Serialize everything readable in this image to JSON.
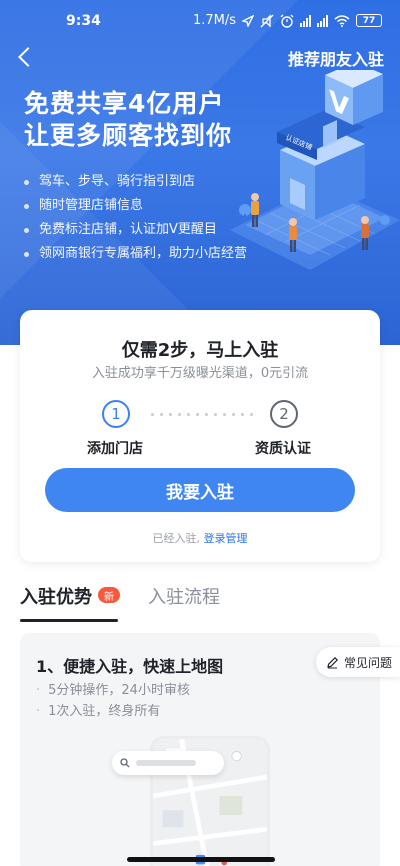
{
  "status_bar": {
    "time": "9:34",
    "network_speed": "1.7M/s",
    "battery": "77",
    "icons": [
      "location-icon",
      "mute-icon",
      "alarm-icon",
      "signal-icon",
      "wifi-icon",
      "battery-icon"
    ]
  },
  "nav": {
    "back_icon": "back-chevron-icon",
    "refer_label": "推荐朋友入驻"
  },
  "hero": {
    "title_line1": "免费共享4亿用户",
    "title_line2": "让更多顾客找到你",
    "bullets": [
      "驾车、步导、骑行指引到店",
      "随时管理店铺信息",
      "免费标注店铺，认证加V更醒目",
      "领网商银行专属福利，助力小店经营"
    ],
    "store_sign": "认证店铺"
  },
  "steps_card": {
    "title": "仅需2步，马上入驻",
    "subtitle": "入驻成功享千万级曝光渠道，0元引流",
    "steps": [
      {
        "number": "1",
        "label": "添加门店"
      },
      {
        "number": "2",
        "label": "资质认证"
      }
    ],
    "cta_label": "我要入驻",
    "footer_text": "已经入驻,",
    "login_label": "登录管理"
  },
  "tabs": {
    "items": [
      {
        "label": "入驻优势",
        "badge": "新"
      },
      {
        "label": "入驻流程"
      }
    ]
  },
  "advantage": {
    "title": "1、便捷入驻，快速上地图",
    "points": [
      "5分钟操作，24小时审核",
      "1次入驻，终身所有"
    ]
  },
  "faq": {
    "label": "常见问题",
    "icon": "edit-pencil-icon"
  },
  "colors": {
    "hero_blue": "#2f6fe4",
    "primary_button": "#3f86f2",
    "link_blue": "#2f74e8",
    "badge_red": "#f55a3d"
  }
}
